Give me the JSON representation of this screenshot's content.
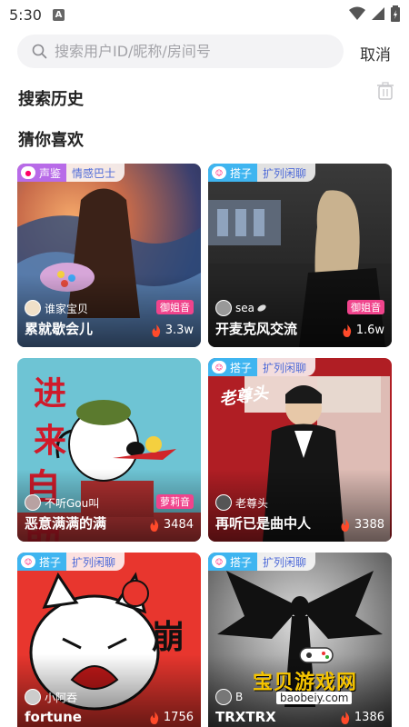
{
  "status_bar": {
    "time": "5:30",
    "notif_letter": "A"
  },
  "search": {
    "placeholder": "搜索用户ID/昵称/房间号",
    "cancel": "取消"
  },
  "sections": {
    "history": "搜索历史",
    "guess": "猜你喜欢"
  },
  "cards": [
    {
      "tag": "声鉴",
      "sub": "情感巴士",
      "host": "谁家宝贝",
      "badge": "御姐音",
      "title": "累就歇会儿",
      "heat": "3.3w"
    },
    {
      "tag": "搭子",
      "sub": "扩列闲聊",
      "host": "sea",
      "badge": "御姐音",
      "title": "开麦克风交流",
      "heat": "1.6w"
    },
    {
      "tag": "",
      "sub": "",
      "host": "不听Gou叫",
      "badge": "萝莉音",
      "title": "恶意满满的满",
      "heat": "3484"
    },
    {
      "tag": "搭子",
      "sub": "扩列闲聊",
      "host": "老尊头",
      "badge": "",
      "title": "再听已是曲中人",
      "heat": "3388"
    },
    {
      "tag": "搭子",
      "sub": "扩列闲聊",
      "host": "小阿吞",
      "badge": "",
      "title": "fortune",
      "heat": "1756"
    },
    {
      "tag": "搭子",
      "sub": "扩列闲聊",
      "host": "B",
      "badge": "",
      "title": "TRXTRX",
      "heat": "1386"
    }
  ],
  "art_text": {
    "card3_top": "进 来",
    "card3_bottom": "自 助",
    "card4": "老尊头",
    "card5": "崩"
  },
  "watermark": {
    "title": "宝贝游戏网",
    "url": "baobeiy.com"
  }
}
